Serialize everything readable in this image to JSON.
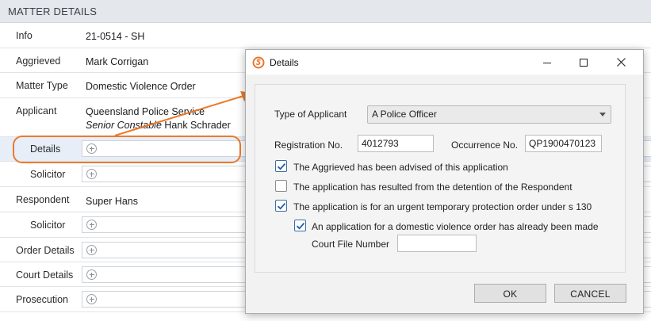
{
  "panel": {
    "title": "MATTER DETAILS",
    "info": {
      "label": "Info",
      "value": "21-0514 - SH"
    },
    "aggrieved": {
      "label": "Aggrieved",
      "value": "Mark Corrigan"
    },
    "matter_type": {
      "label": "Matter Type",
      "value": "Domestic Violence Order"
    },
    "applicant": {
      "label": "Applicant",
      "line1": "Queensland Police Service",
      "rank": "Senior Constable",
      "name": "Hank Schrader"
    },
    "applicant_details": {
      "label": "Details"
    },
    "applicant_solicitor": {
      "label": "Solicitor"
    },
    "respondent": {
      "label": "Respondent",
      "value": "Super Hans"
    },
    "respondent_solicitor": {
      "label": "Solicitor"
    },
    "order_details": {
      "label": "Order Details"
    },
    "court_details": {
      "label": "Court Details"
    },
    "prosecution": {
      "label": "Prosecution"
    }
  },
  "dialog": {
    "title": "Details",
    "type_label": "Type of Applicant",
    "type_value": "A Police Officer",
    "registration_label": "Registration No.",
    "registration_value": "4012793",
    "occurrence_label": "Occurrence No.",
    "occurrence_value": "QP1900470123",
    "checkboxes": [
      {
        "label": "The Aggrieved has been advised of this application",
        "checked": true
      },
      {
        "label": "The application has resulted from the detention of the Respondent",
        "checked": false
      },
      {
        "label": "The application is for an urgent temporary protection order under s 130",
        "checked": true
      },
      {
        "label": "An application for a domestic violence order has already been made",
        "checked": true
      }
    ],
    "court_file_label": "Court File Number",
    "court_file_value": "",
    "ok_label": "OK",
    "cancel_label": "CANCEL"
  },
  "colors": {
    "accent": "#ec7a2b",
    "highlight_row": "#e7eef8",
    "checkbox": "#3a6ea5"
  }
}
